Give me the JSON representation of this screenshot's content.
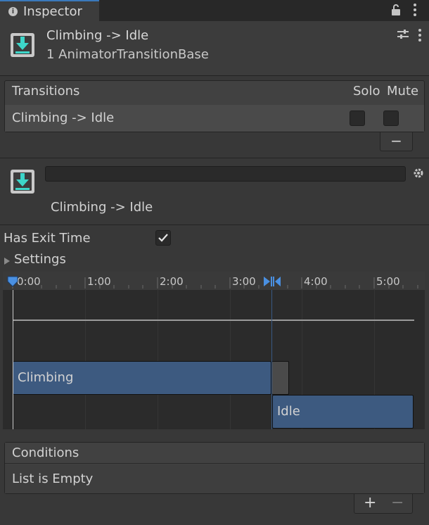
{
  "tab": {
    "title": "Inspector"
  },
  "header": {
    "title": "Climbing -> Idle",
    "subtitle": "1 AnimatorTransitionBase"
  },
  "transitions": {
    "header": "Transitions",
    "solo_label": "Solo",
    "mute_label": "Mute",
    "rows": [
      {
        "label": "Climbing -> Idle",
        "solo": false,
        "mute": false
      }
    ],
    "remove_label": "−"
  },
  "transition_detail": {
    "name_value": "",
    "title": "Climbing -> Idle"
  },
  "has_exit_time": {
    "label": "Has Exit Time",
    "checked": true
  },
  "settings": {
    "label": "Settings"
  },
  "timeline": {
    "ticks": [
      "0:00",
      "1:00",
      "2:00",
      "3:00",
      "4:00",
      "5:00"
    ],
    "source_state": "Climbing",
    "dest_state": "Idle"
  },
  "conditions": {
    "header": "Conditions",
    "empty_text": "List is Empty",
    "add_label": "+",
    "remove_label": "−"
  },
  "colors": {
    "accent": "#3a79bb",
    "clip": "#3d5a80",
    "icon_teal": "#3dd6c9"
  }
}
